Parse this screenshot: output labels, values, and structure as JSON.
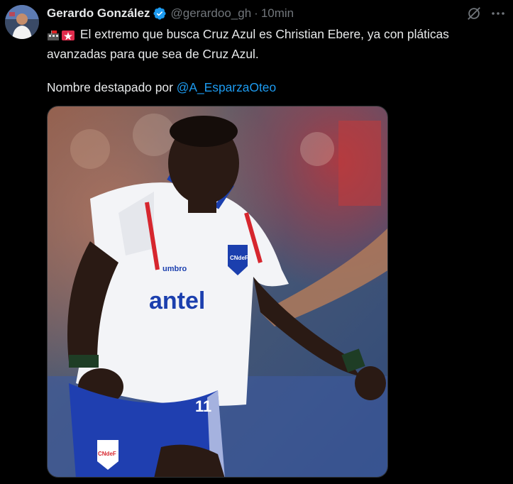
{
  "author": {
    "name": "Gerardo González",
    "handle": "@gerardoo_gh",
    "separator": "·",
    "time": "10min",
    "verified": true
  },
  "tweet": {
    "emoji_icons": [
      "building-flag-icon",
      "alert-siren-icon"
    ],
    "text_line1": "El extremo que busca Cruz Azul es Christian Ebere, ya con pláticas avanzadas para que sea de Cruz Azul.",
    "text_line2_prefix": "Nombre destapado por ",
    "mention": "@A_EsparzaOteo"
  },
  "photo": {
    "jersey_sponsor": "antel",
    "kit_brand": "umbro",
    "badge": "CNdeF",
    "shorts_number": "11"
  },
  "colors": {
    "background": "#000000",
    "text": "#e7e9ea",
    "muted": "#71767b",
    "accent": "#1d9bf0"
  }
}
